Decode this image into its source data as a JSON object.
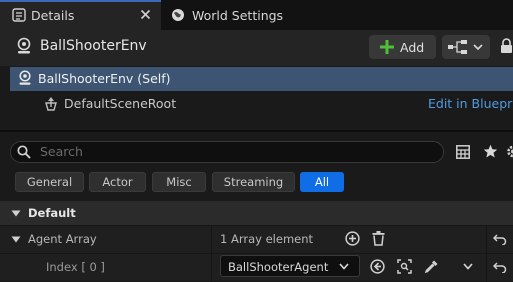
{
  "tabs": [
    {
      "label": "Details",
      "active": true
    },
    {
      "label": "World Settings",
      "active": false
    }
  ],
  "header": {
    "actor_title": "BallShooterEnv",
    "add_label": "Add"
  },
  "components": [
    {
      "label": "BallShooterEnv (Self)",
      "selected": true
    },
    {
      "label": "DefaultSceneRoot",
      "selected": false
    }
  ],
  "edit_in_blueprint": "Edit in Blueprint",
  "search": {
    "placeholder": "Search"
  },
  "filters": [
    {
      "label": "General",
      "active": false
    },
    {
      "label": "Actor",
      "active": false
    },
    {
      "label": "Misc",
      "active": false
    },
    {
      "label": "Streaming",
      "active": false
    },
    {
      "label": "All",
      "active": true
    }
  ],
  "category": "Default",
  "properties": {
    "agent_array": {
      "label": "Agent Array",
      "value": "1 Array element"
    },
    "index": {
      "label": "Index [ 0 ]",
      "value": "BallShooterAgent"
    }
  },
  "colors": {
    "accent": "#0f6ee6",
    "add_green": "#4fbf3a",
    "link": "#4f9be6",
    "selection": "#3d5572"
  }
}
